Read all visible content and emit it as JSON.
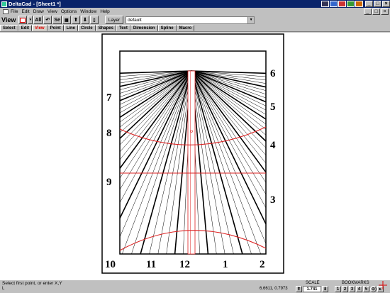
{
  "window": {
    "title": "DeltaCad - [Sheet1 *]"
  },
  "menu": [
    "File",
    "Edit",
    "Draw",
    "View",
    "Options",
    "Window",
    "Help"
  ],
  "toolbar": {
    "view_title": "View",
    "all_label": "All",
    "sel_label": "Se",
    "layer_label": "Layer",
    "layer_value": "default"
  },
  "tabs": [
    "Select",
    "Edit",
    "View",
    "Point",
    "Line",
    "Circle",
    "Shapes",
    "Text",
    "Dimension",
    "Spline",
    "Macro"
  ],
  "active_tab": "View",
  "status": {
    "prompt": "Select first point, or enter X,Y",
    "coords": "6.6611, 0.7973",
    "scale_label": "SCALE",
    "scale_value": "1.741",
    "bookmarks_label": "BOOKMARKS",
    "bookmarks": [
      "1",
      "2",
      "3",
      "4",
      "5"
    ],
    "corner": "L"
  },
  "dial": {
    "hour_labels": {
      "six": "6",
      "seven": "7",
      "five": "5",
      "eight": "8",
      "four": "4",
      "nine": "9",
      "three": "3",
      "ten": "10",
      "eleven": "11",
      "twelve": "12",
      "one": "1",
      "two": "2"
    },
    "line_color": "#000000",
    "curve_color": "#dd2222"
  },
  "colors": {
    "titlebar": "#0a246a",
    "face": "#c0c0c0",
    "accent_red": "#dd0000"
  }
}
